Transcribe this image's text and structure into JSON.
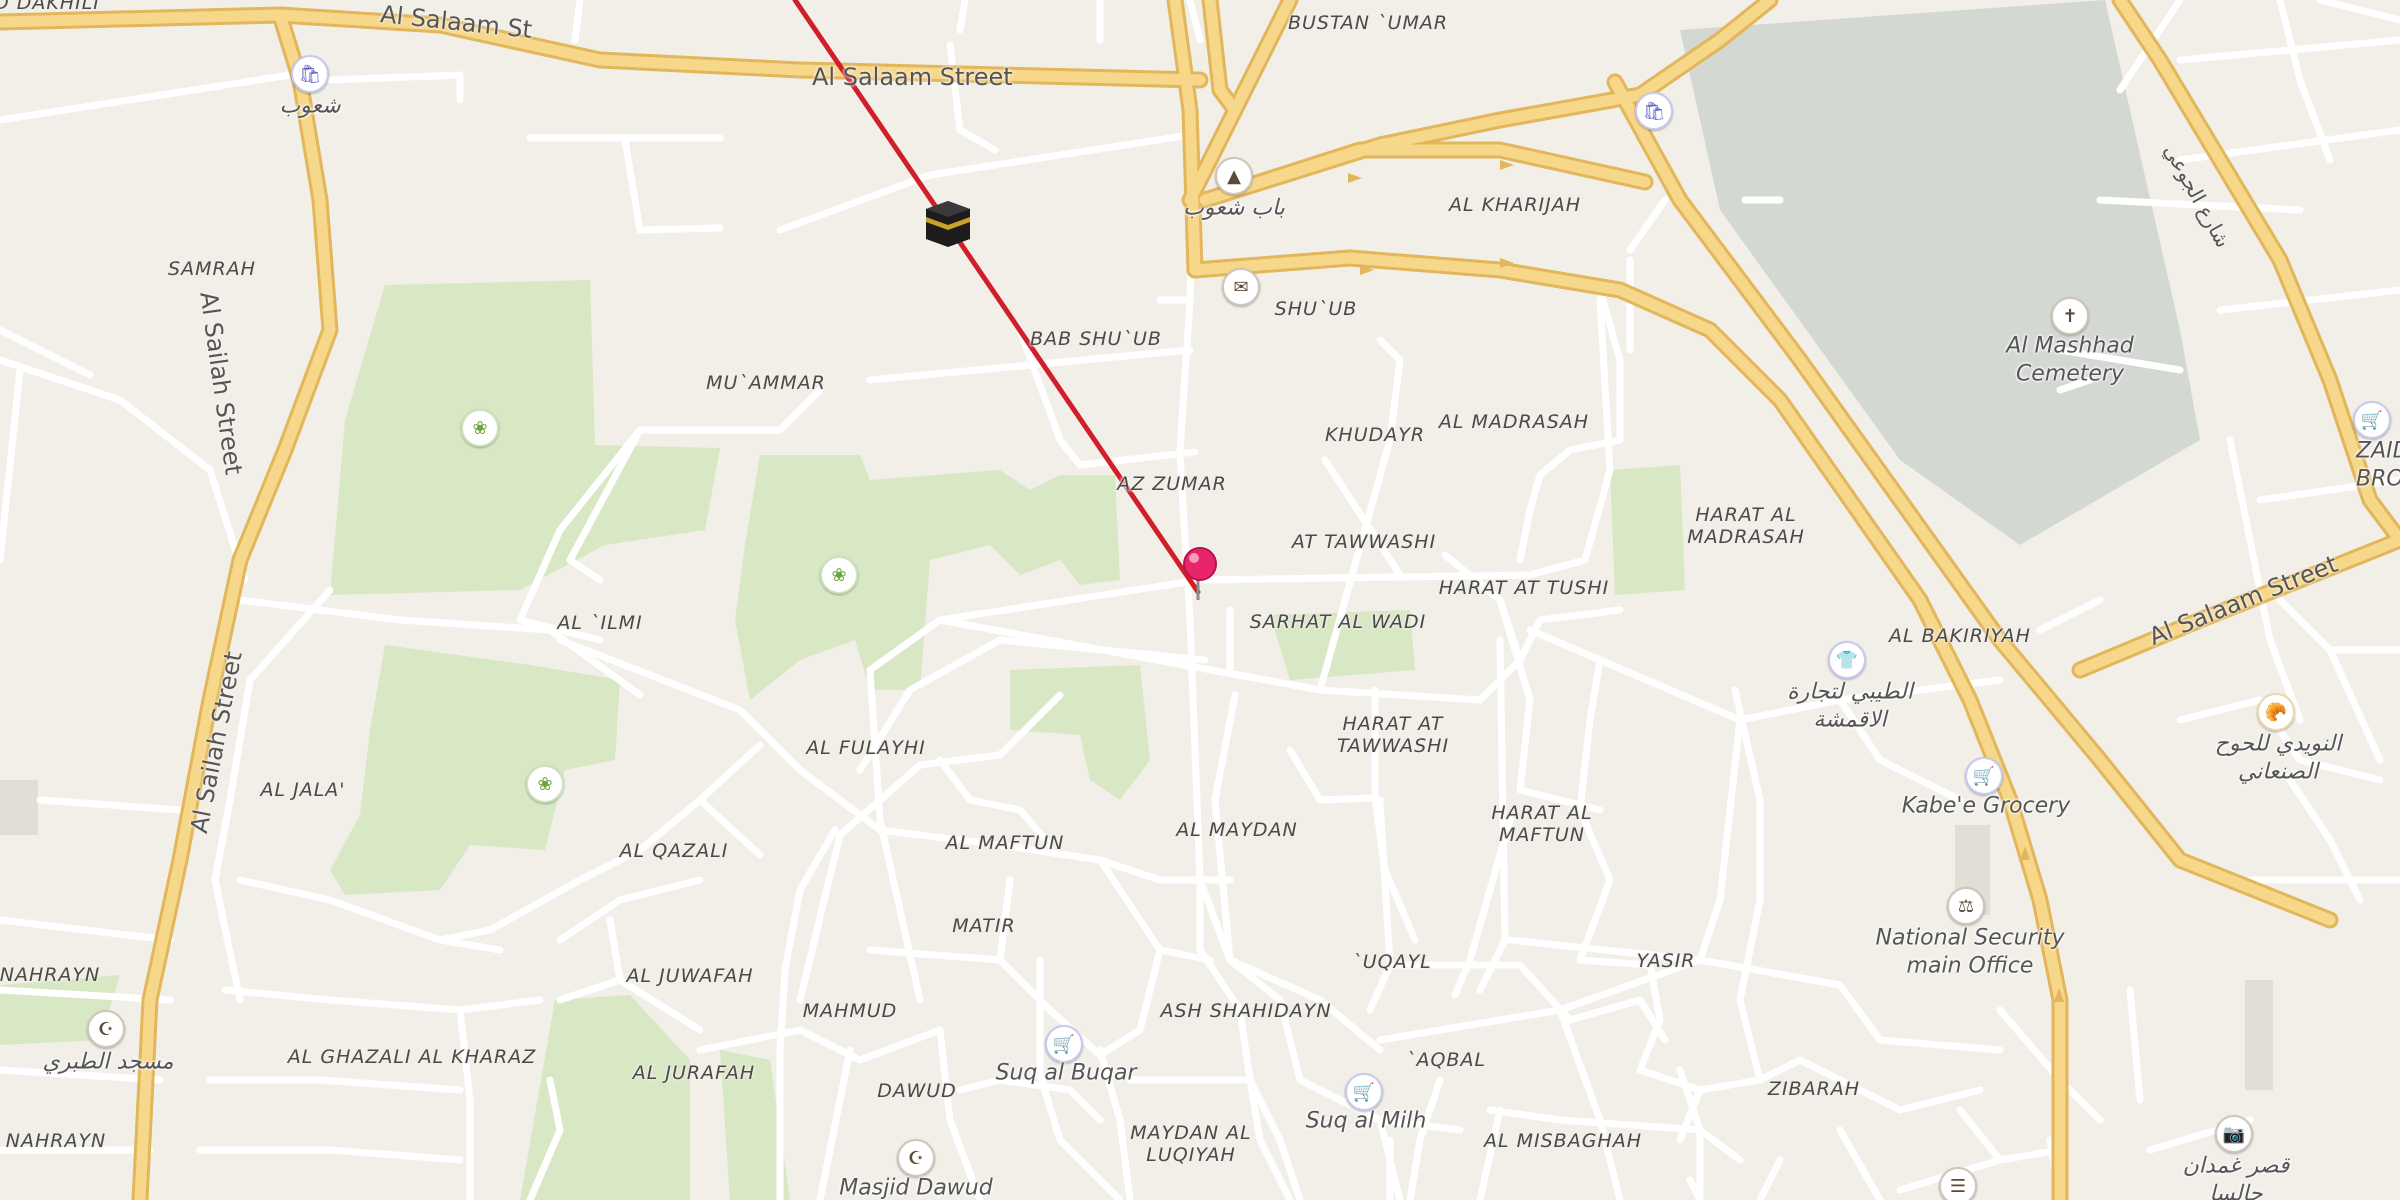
{
  "colors": {
    "background": "#f2efe9",
    "park": "#d8e7c4",
    "cemetery": "#d4d8d3",
    "major_road": "#f7d78a",
    "major_road_casing": "#e2b65a",
    "minor_road": "#ffffff",
    "route_line": "#d11f2a",
    "pin": "#e8246a"
  },
  "route": {
    "description": "red straight line from top edge to the location pin"
  },
  "streets": [
    {
      "name": "Al Salaam St"
    },
    {
      "name": "Al Salaam Street"
    },
    {
      "name": "Al Sailah Street"
    },
    {
      "name": "Al Sailah Street"
    },
    {
      "name": "Al Salaam Street"
    },
    {
      "name": "شارع الجوعي"
    }
  ],
  "districts": [
    "AD DAKHILI",
    "BUSTAN `UMAR",
    "SAMRAH",
    "AL KHARIJAH",
    "SHU`UB",
    "BAB SHU`UB",
    "MU`AMMAR",
    "KHUDAYR",
    "AL MADRASAH",
    "AZ ZUMAR",
    "HARAT AL\nMADRASAH",
    "AT TAWWASHI",
    "HARAT AT TUSHI",
    "AL `ILMI",
    "SARHAT AL WADI",
    "AL BAKIRIYAH",
    "HARAT AT\nTAWWASHI",
    "AL FULAYHI",
    "AL JALA'",
    "HARAT AL\nMAFTUN",
    "AL MAYDAN",
    "AL MAFTUN",
    "AL QAZALI",
    "MATIR",
    "`UQAYL",
    "YASIR",
    "NAHRAYN",
    "AL JUWAFAH",
    "MAHMUD",
    "ASH SHAHIDAYN",
    "AL GHAZALI AL KHARAZ",
    "AL JURAFAH",
    "DAWUD",
    "`AQBAL",
    "ZIBARAH",
    "MAYDAN AL\nLUQIYAH",
    "AL MISBAGHAH",
    "NAHRAYN"
  ],
  "pois": [
    {
      "name": "شعوب",
      "icon": "shopping-bag-icon"
    },
    {
      "name": "باب شعوب",
      "icon": "monument-icon"
    },
    {
      "name": "",
      "icon": "post-office-icon"
    },
    {
      "name": "",
      "icon": "shopping-bag-icon"
    },
    {
      "name": "Al Mashhad\nCemetery",
      "icon": "cemetery-icon"
    },
    {
      "name": "ZAID QAS\nBROHERS S",
      "icon": "shopping-cart-icon"
    },
    {
      "name": "الطيبي لتجارة\nالاقمشة",
      "icon": "clothing-icon"
    },
    {
      "name": "النويدي للحوح\nالصنعاني",
      "icon": "bakery-icon"
    },
    {
      "name": "Kabe'e Grocery",
      "icon": "shopping-cart-icon"
    },
    {
      "name": "National Security\nmain Office",
      "icon": "government-icon"
    },
    {
      "name": "مسجد الطبري",
      "icon": "mosque-icon"
    },
    {
      "name": "Suq al Buqar",
      "icon": "shopping-cart-icon"
    },
    {
      "name": "Suq al Milh",
      "icon": "shopping-cart-icon"
    },
    {
      "name": "Masjid Dawud",
      "icon": "mosque-icon"
    },
    {
      "name": "قصر غمدان\nحالسا",
      "icon": "camera-icon"
    },
    {
      "name": "",
      "icon": "park-icon"
    },
    {
      "name": "",
      "icon": "park-icon"
    },
    {
      "name": "",
      "icon": "park-icon"
    },
    {
      "name": "",
      "icon": "kaaba-icon"
    }
  ]
}
